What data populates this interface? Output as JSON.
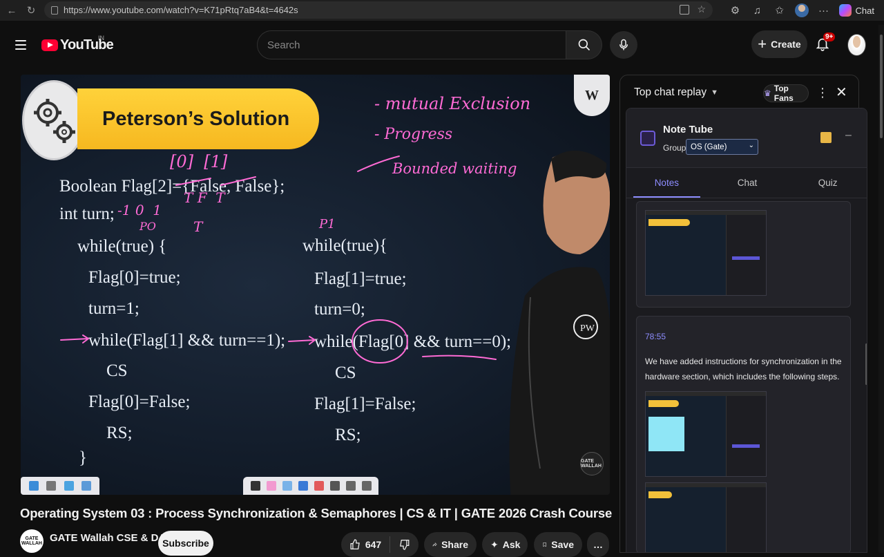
{
  "browser": {
    "url": "https://www.youtube.com/watch?v=K71pRtq7aB4&t=4642s",
    "copilot_label": "Chat"
  },
  "header": {
    "logo_text": "YouTube",
    "country_code": "IN",
    "search_placeholder": "Search",
    "create_label": "Create",
    "notifications_badge": "9+"
  },
  "video": {
    "slide_title": "Peterson’s Solution",
    "pw_logo": "W",
    "code": {
      "line1": "Boolean Flag[2]={False, False};",
      "line2": "int turn;",
      "p0_while": "while(true) {",
      "p0_flag": "Flag[0]=true;",
      "p0_turn": "turn=1;",
      "p0_wait": "while(Flag[1] && turn==1);",
      "p0_cs": "CS",
      "p0_reset": "Flag[0]=False;",
      "p0_rs": "RS;",
      "p0_close": "}",
      "p1_while": "while(true){",
      "p1_flag": "Flag[1]=true;",
      "p1_turn": "turn=0;",
      "p1_wait": "while(Flag[0] && turn==0);",
      "p1_cs": "CS",
      "p1_reset": "Flag[1]=False;",
      "p1_rs": "RS;"
    },
    "handwriting": {
      "h1": "- mutual Exclusion",
      "h2": "- Progress",
      "h3": "Bounded waiting",
      "idx": "[0]  [1]",
      "p0": "PO",
      "p1": "P1",
      "turn_marks": "-1 0  1",
      "tf": "T F  T",
      "t": "T"
    },
    "badge_text": "GATE WALLAH"
  },
  "meta": {
    "title": "Operating System 03 : Process Synchronization & Semaphores | CS & IT | GATE 2026 Crash Course",
    "channel": "GATE Wallah CSE & DA",
    "channel_avatar": "GATE WALLAH",
    "subscribe_label": "Subscribe",
    "likes": "647",
    "share_label": "Share",
    "ask_label": "Ask",
    "save_label": "Save",
    "more_label": "…"
  },
  "chat": {
    "title": "Top chat replay",
    "top_fans_label": "Top Fans",
    "close_label": "✕"
  },
  "notetube": {
    "title": "Note Tube",
    "group_label": "Group:",
    "group_value": "OS (Gate)",
    "tabs": [
      "Notes",
      "Chat",
      "Quiz"
    ],
    "note_time": "78:55",
    "note_text": "We have added instructions for synchronization in the hardware section, which includes the following steps."
  },
  "colors": {
    "accent": "#8e8dff",
    "youtube_red": "#ff0033",
    "slide_yellow": "#f6b820",
    "handwriting": "#ff6bd5"
  }
}
